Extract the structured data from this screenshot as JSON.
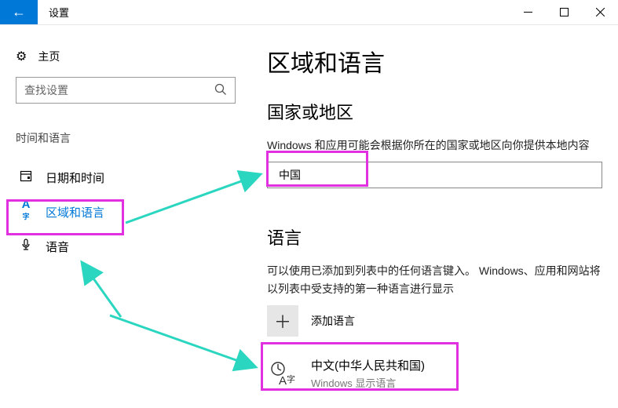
{
  "titlebar": {
    "title": "设置"
  },
  "sidebar": {
    "home": "主页",
    "search_placeholder": "查找设置",
    "group_title": "时间和语言",
    "items": [
      {
        "icon": "calendar-icon",
        "glyph": "📅",
        "label": "日期和时间"
      },
      {
        "icon": "globe-a-icon",
        "glyph": "Aᶻ",
        "label": "区域和语言"
      },
      {
        "icon": "mic-icon",
        "glyph": "🎤",
        "label": "语音"
      }
    ],
    "active_index": 1
  },
  "content": {
    "page_title": "区域和语言",
    "country_heading": "国家或地区",
    "country_desc": "Windows 和应用可能会根据你所在的国家或地区向你提供本地内容",
    "country_value": "中国",
    "language_heading": "语言",
    "language_desc": "可以使用已添加到列表中的任何语言键入。 Windows、应用和网站将以列表中受支持的第一种语言进行显示",
    "add_language_label": "添加语言",
    "languages": [
      {
        "name": "中文(中华人民共和国)",
        "subtitle": "Windows 显示语言"
      }
    ]
  },
  "annotations": {
    "highlight_color": "#e030e0",
    "arrow_color": "#2bd6c0"
  }
}
